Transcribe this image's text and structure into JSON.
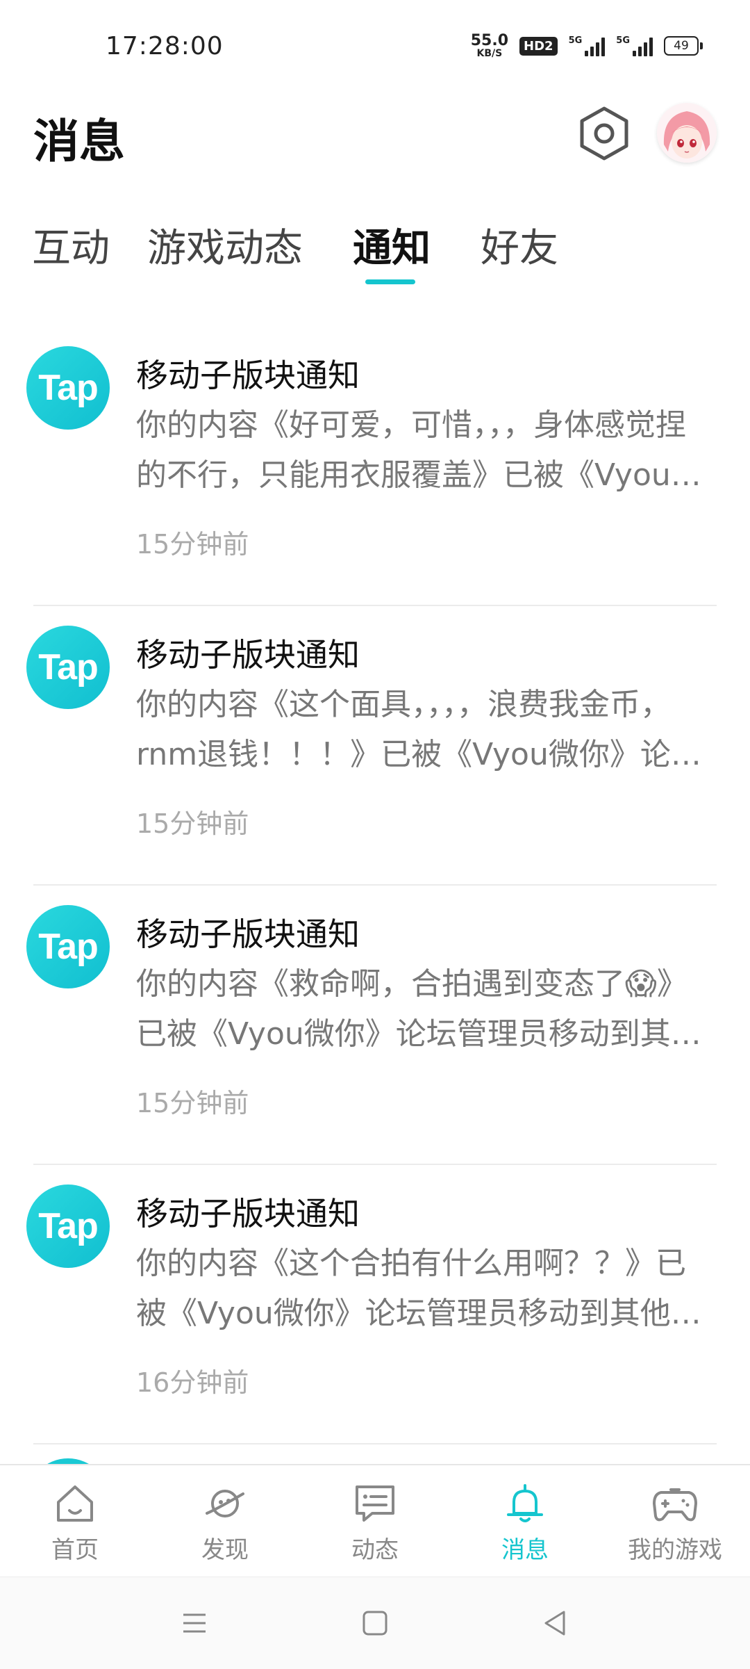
{
  "status_bar": {
    "time": "17:28:00",
    "net_speed_value": "55.0",
    "net_speed_unit": "KB/S",
    "hd_badge": "HD2",
    "signal1_label": "5G",
    "signal2_label": "5G",
    "battery": "49"
  },
  "header": {
    "title": "消息",
    "settings_icon": "hexagon-settings-icon",
    "avatar_icon": "anime-avatar"
  },
  "tabs": [
    {
      "label": "互动",
      "active": false
    },
    {
      "label": "游戏动态",
      "active": false
    },
    {
      "label": "通知",
      "active": true
    },
    {
      "label": "好友",
      "active": false
    }
  ],
  "notifications": [
    {
      "logo": "Tap",
      "title": "移动子版块通知",
      "content": "你的内容《好可爱，可惜，，，身体感觉捏的不行，只能用衣服覆盖》已被《Vyou微你》论坛管理员移动到其他子版块",
      "time": "15分钟前"
    },
    {
      "logo": "Tap",
      "title": "移动子版块通知",
      "content": "你的内容《这个面具，，，，浪费我金币，rnm退钱！！！》已被《Vyou微你》论坛管理员移动到其他子版块",
      "time": "15分钟前"
    },
    {
      "logo": "Tap",
      "title": "移动子版块通知",
      "content": "你的内容《救命啊，合拍遇到变态了😱》已被《Vyou微你》论坛管理员移动到其他子版块",
      "time": "15分钟前"
    },
    {
      "logo": "Tap",
      "title": "移动子版块通知",
      "content": "你的内容《这个合拍有什么用啊？？》已被《Vyou微你》论坛管理员移动到其他子版块",
      "time": "16分钟前"
    }
  ],
  "bottom_nav": [
    {
      "label": "首页",
      "icon": "home-icon",
      "active": false
    },
    {
      "label": "发现",
      "icon": "planet-icon",
      "active": false
    },
    {
      "label": "动态",
      "icon": "message-card-icon",
      "active": false
    },
    {
      "label": "消息",
      "icon": "bell-icon",
      "active": true
    },
    {
      "label": "我的游戏",
      "icon": "gamepad-icon",
      "active": false
    }
  ],
  "colors": {
    "accent": "#15c5ce",
    "inactive": "#888888"
  }
}
